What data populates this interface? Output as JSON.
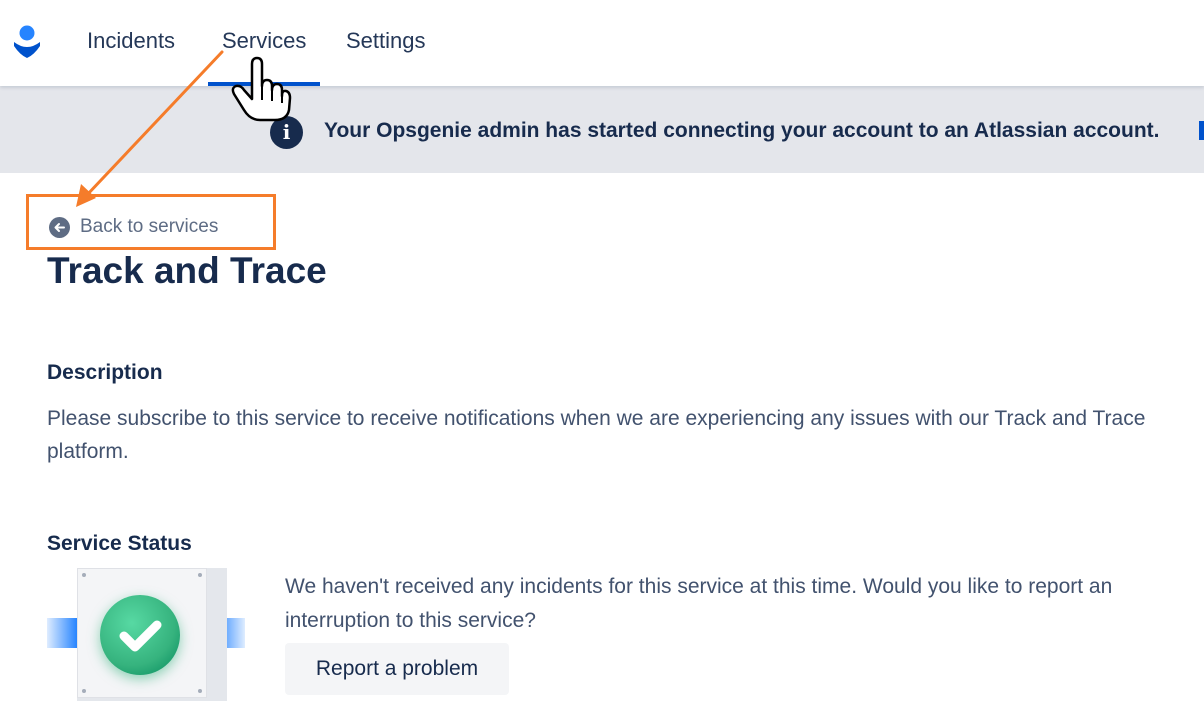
{
  "nav": {
    "items": [
      "Incidents",
      "Services",
      "Settings"
    ],
    "active": "Services"
  },
  "banner": {
    "text": "Your Opsgenie admin has started connecting your account to an Atlassian account."
  },
  "back_link": {
    "label": "Back to services"
  },
  "service": {
    "title": "Track and Trace",
    "description_heading": "Description",
    "description": "Please subscribe to this service to receive notifications when we are experiencing any issues with our Track and Trace platform.",
    "status_heading": "Service Status",
    "status_message": "We haven't received any incidents for this service at this time. Would you like to report an interruption to this service?",
    "report_button": "Report a problem"
  },
  "colors": {
    "accent": "#0052CC",
    "highlight": "#F57C2A",
    "success": "#36B37E",
    "banner_bg": "#E4E6EB"
  },
  "icons": [
    "opsgenie-logo-icon",
    "info-icon",
    "back-arrow-icon",
    "check-icon",
    "hand-cursor-icon"
  ]
}
